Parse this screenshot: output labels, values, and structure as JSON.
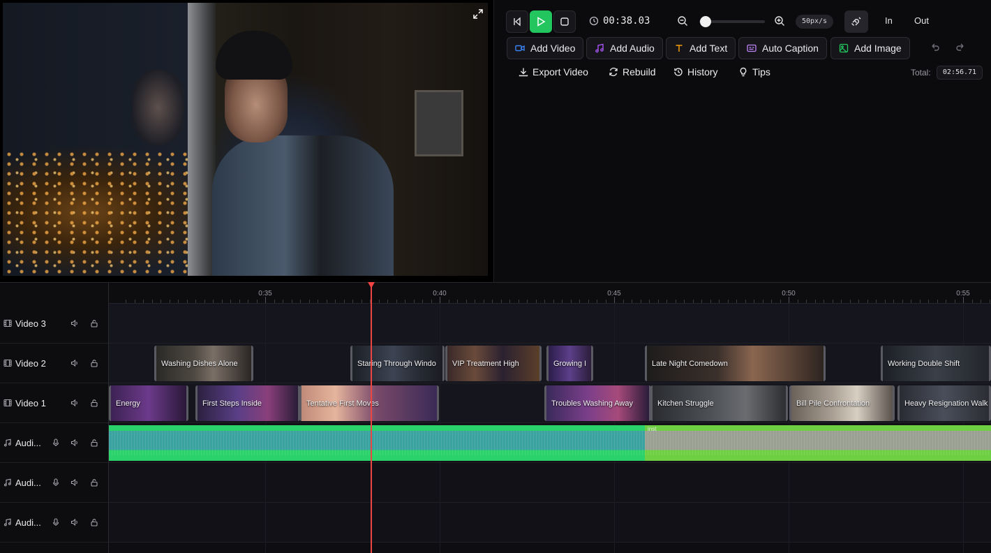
{
  "controls": {
    "time": "00:38.03",
    "zoom_level": "50px/s",
    "zoom_fraction": 0.0,
    "in_label": "In",
    "out_label": "Out",
    "accent_color": "#22c55e"
  },
  "add_buttons": {
    "video": "Add Video",
    "audio": "Add Audio",
    "text": "Add Text",
    "caption": "Auto Caption",
    "image": "Add Image"
  },
  "actions": {
    "export": "Export Video",
    "rebuild": "Rebuild",
    "history": "History",
    "tips": "Tips",
    "total_label": "Total:",
    "total_value": "02:56.71"
  },
  "ruler": {
    "labels": [
      "0:35",
      "0:40",
      "0:45",
      "0:50",
      "0:55"
    ]
  },
  "tracks": [
    {
      "name": "Video 3",
      "kind": "video"
    },
    {
      "name": "Video 2",
      "kind": "video"
    },
    {
      "name": "Video 1",
      "kind": "video"
    },
    {
      "name": "Audi...",
      "kind": "audio"
    },
    {
      "name": "Audi...",
      "kind": "audio"
    },
    {
      "name": "Audi...",
      "kind": "audio"
    }
  ],
  "clips": {
    "video2": [
      {
        "label": "Washing Dishes Alone"
      },
      {
        "label": "Staring Through Windo"
      },
      {
        "label": "VIP Treatment High"
      },
      {
        "label": "Growing I"
      },
      {
        "label": "Late Night Comedown"
      },
      {
        "label": "Working Double Shift"
      }
    ],
    "video1": [
      {
        "label": "Energy"
      },
      {
        "label": "First Steps Inside"
      },
      {
        "label": "Tentative First Moves"
      },
      {
        "label": "Troubles Washing Away"
      },
      {
        "label": "Kitchen Struggle"
      },
      {
        "label": "Bill Pile Confrontation"
      },
      {
        "label": "Heavy Resignation Walk"
      }
    ],
    "audio1": [
      {
        "label": ""
      },
      {
        "label": "inst"
      }
    ]
  },
  "colors": {
    "playhead": "#ef4444",
    "audio_clip_1": "#3aa3a0",
    "audio_clip_1_edge": "#2bd26b",
    "audio_clip_2": "#9aa092",
    "audio_clip_2_edge": "#6fcf42"
  }
}
